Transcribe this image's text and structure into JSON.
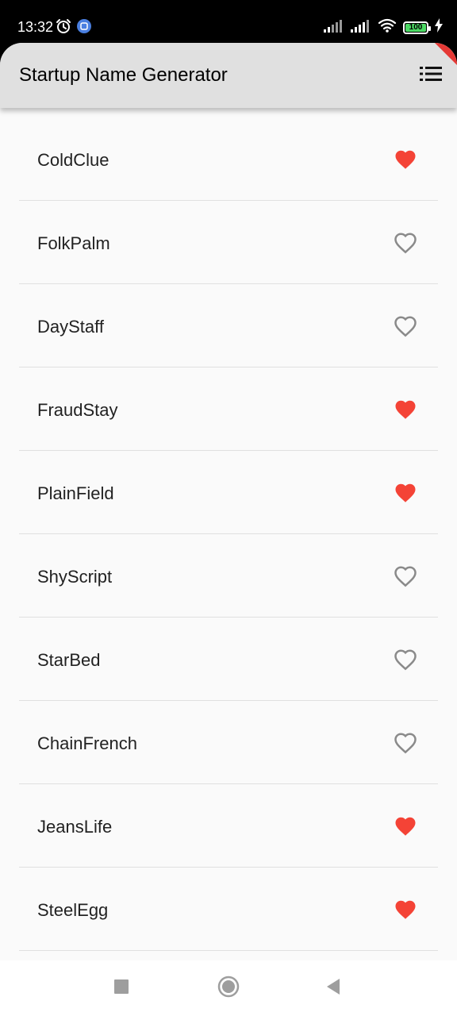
{
  "status_bar": {
    "time": "13:32",
    "battery_level": "100",
    "battery_fraction": 1.0,
    "icons": [
      "alarm-icon",
      "app-notification-icon",
      "signal-icon",
      "signal-icon",
      "wifi-icon",
      "battery-icon",
      "charging-icon"
    ]
  },
  "app_bar": {
    "title": "Startup Name Generator",
    "action_icon": "list-icon",
    "background": "#e0e0e0"
  },
  "colors": {
    "favorite": "#f44336",
    "not_favorite": "#8a8a8a",
    "divider": "#e0e0e0",
    "background": "#fafafa"
  },
  "list": {
    "items": [
      {
        "name": "ColdClue",
        "favorite": true
      },
      {
        "name": "FolkPalm",
        "favorite": false
      },
      {
        "name": "DayStaff",
        "favorite": false
      },
      {
        "name": "FraudStay",
        "favorite": true
      },
      {
        "name": "PlainField",
        "favorite": true
      },
      {
        "name": "ShyScript",
        "favorite": false
      },
      {
        "name": "StarBed",
        "favorite": false
      },
      {
        "name": "ChainFrench",
        "favorite": false
      },
      {
        "name": "JeansLife",
        "favorite": true
      },
      {
        "name": "SteelEgg",
        "favorite": true
      }
    ]
  },
  "nav_bar": {
    "buttons": [
      "recents-square-icon",
      "home-circle-icon",
      "back-triangle-icon"
    ]
  }
}
